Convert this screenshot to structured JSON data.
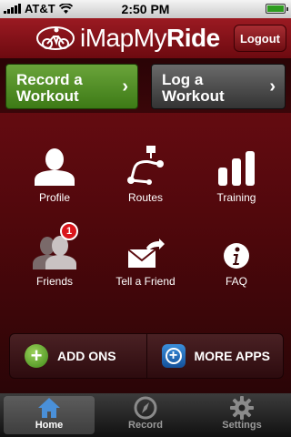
{
  "status_bar": {
    "carrier": "AT&T",
    "time": "2:50 PM"
  },
  "header": {
    "app_name_part1": "iMapMy",
    "app_name_part2": "Ride",
    "logout_label": "Logout"
  },
  "actions": {
    "record": {
      "line1": "Record a",
      "line2": "Workout",
      "chevron": "›"
    },
    "log": {
      "line1": "Log a",
      "line2": "Workout",
      "chevron": "›"
    }
  },
  "menu": {
    "profile": "Profile",
    "routes": "Routes",
    "training": "Training",
    "friends": "Friends",
    "friends_badge": "1",
    "tell_a_friend": "Tell a Friend",
    "faq": "FAQ"
  },
  "bottom_buttons": {
    "add_ons": "ADD ONS",
    "more_apps": "MORE APPS"
  },
  "tabs": [
    {
      "label": "Home",
      "icon": "home-icon",
      "active": true
    },
    {
      "label": "Record",
      "icon": "compass-icon",
      "active": false
    },
    {
      "label": "Settings",
      "icon": "gear-icon",
      "active": false
    }
  ],
  "colors": {
    "brand_red": "#8a1219",
    "record_green": "#4f8c23",
    "tab_active": "#4a90d9"
  }
}
